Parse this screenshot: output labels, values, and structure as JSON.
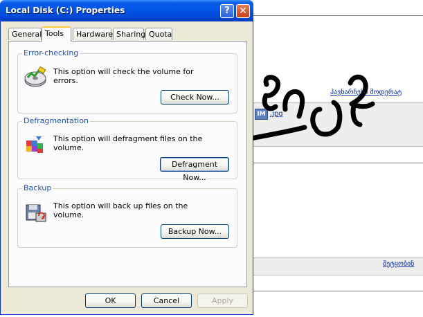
{
  "window": {
    "title": "Local Disk (C:) Properties",
    "help_label": "?",
    "close_label": "✕"
  },
  "tabs": [
    {
      "label": "General"
    },
    {
      "label": "Tools",
      "active": true
    },
    {
      "label": "Hardware"
    },
    {
      "label": "Sharing"
    },
    {
      "label": "Quota"
    }
  ],
  "groups": {
    "error_checking": {
      "label": "Error-checking",
      "text": "This option will check the volume for errors.",
      "button": "Check Now..."
    },
    "defrag": {
      "label": "Defragmentation",
      "text": "This option will defragment files on the volume.",
      "button": "Defragment Now..."
    },
    "backup": {
      "label": "Backup",
      "text": "This option will back up files on the volume.",
      "button": "Backup Now..."
    }
  },
  "footer": {
    "ok": "OK",
    "cancel": "Cancel",
    "apply": "Apply"
  },
  "background": {
    "im_badge": "IM",
    "link_top": "ჰავნარჩენი მოდერატ",
    "link_mid": ".jpg",
    "link_bottom": "შეტყობინ"
  },
  "colors": {
    "title_bar": "#0055e5",
    "group_label": "#1f4fb8",
    "window_face": "#ece9d8"
  }
}
